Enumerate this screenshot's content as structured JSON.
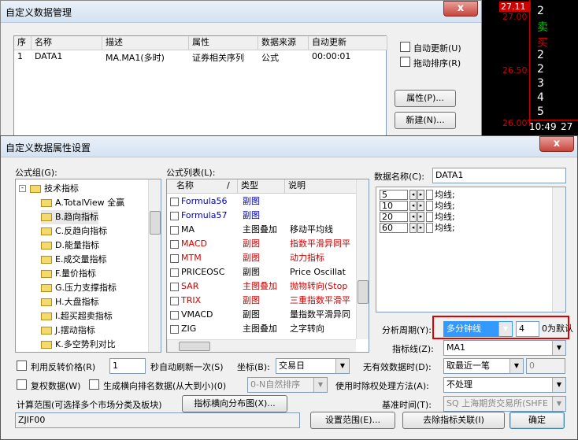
{
  "market": {
    "prices": [
      "27.11",
      "27.00",
      "26.50",
      "26.00"
    ],
    "right_labels": [
      "2",
      "卖",
      "买",
      "2",
      "2",
      "3",
      "4",
      "5"
    ],
    "time": "10:49",
    "time_val": "27"
  },
  "mgr": {
    "title": "自定义数据管理",
    "close": "x",
    "columns": [
      "序",
      "名称",
      "描述",
      "属性",
      "数据来源",
      "自动更新"
    ],
    "row": [
      "1",
      "DATA1",
      "MA.MA1(多时)",
      "证券相关序列",
      "公式",
      "00:00:01"
    ],
    "auto_update": "自动更新(U)",
    "auto_sort": "拖动排序(R)",
    "props_btn": "属性(P)...",
    "new_btn": "新建(N)..."
  },
  "dlg": {
    "title": "自定义数据属性设置",
    "close": "x",
    "group_label": "公式组(G):",
    "tree_root": "技术指标",
    "tree": [
      "A.TotalView 全赢",
      "B.趋向指标",
      "C.反趋向指标",
      "D.能量指标",
      "E.成交量指标",
      "F.量价指标",
      "G.压力支撑指标",
      "H.大盘指标",
      "I.超买超卖指标",
      "J.摆动指标",
      "K.多空势利对比"
    ],
    "list_label": "公式列表(L):",
    "list_cols": [
      "名称",
      "/",
      "类型",
      "说明"
    ],
    "formulas": [
      {
        "name": "Formula56",
        "type": "副图",
        "desc": "",
        "color": "blue"
      },
      {
        "name": "Formula57",
        "type": "副图",
        "desc": "",
        "color": "blue"
      },
      {
        "name": "MA",
        "type": "主图叠加",
        "desc": "移动平均线",
        "color": "black"
      },
      {
        "name": "MACD",
        "type": "副图",
        "desc": "指数平滑异同平",
        "color": "red"
      },
      {
        "name": "MTM",
        "type": "副图",
        "desc": "动力指标",
        "color": "red"
      },
      {
        "name": "PRICEOSC",
        "type": "副图",
        "desc": "Price Oscillat",
        "color": "black"
      },
      {
        "name": "SAR",
        "type": "主图叠加",
        "desc": "抛物转向(Stop",
        "color": "red"
      },
      {
        "name": "TRIX",
        "type": "副图",
        "desc": "三重指数平滑平",
        "color": "red"
      },
      {
        "name": "VMACD",
        "type": "副图",
        "desc": "量指数平滑异同",
        "color": "black"
      },
      {
        "name": "ZIG",
        "type": "主图叠加",
        "desc": "之字转向",
        "color": "black"
      }
    ],
    "data_name_label": "数据名称(C):",
    "data_name": "DATA1",
    "params": [
      {
        "value": "5",
        "label": "均线;"
      },
      {
        "value": "10",
        "label": "均线;"
      },
      {
        "value": "20",
        "label": "均线;"
      },
      {
        "value": "60",
        "label": "均线;"
      }
    ],
    "period_label": "分析周期(Y):",
    "period": "多分钟线",
    "period_n": "4",
    "period_unit": "0为默认",
    "line_label": "指标线(Z):",
    "line": "MA1",
    "reverse_price": "利用反转价格(R)",
    "refresh_n": "1",
    "refresh_label": "秒自动刷新一次(S)",
    "coord_label": "坐标(B):",
    "coord": "交易日",
    "invalid_label": "无有效数据时(D):",
    "invalid": "取最近一笔",
    "invalid_n": "0",
    "restore": "复权数据(W)",
    "gen_rank": "生成横向排名数据(从大到小)(0)",
    "rank_mode": "0-N自然排序",
    "time_rule_label": "使用时除权处理方法(A):",
    "time_rule": "不处理",
    "calc_range": "计算范围(可选择多个市场分类及板块)",
    "dist_btn": "指标横向分布图(X)...",
    "base_time_label": "基准时间(T):",
    "base_time": "SQ 上海期货交易所(SHFE",
    "range_value": "ZJIF00",
    "set_range_btn": "设置范围(E)...",
    "remove_btn": "去除指标关联(I)",
    "ok_btn": "确定"
  }
}
